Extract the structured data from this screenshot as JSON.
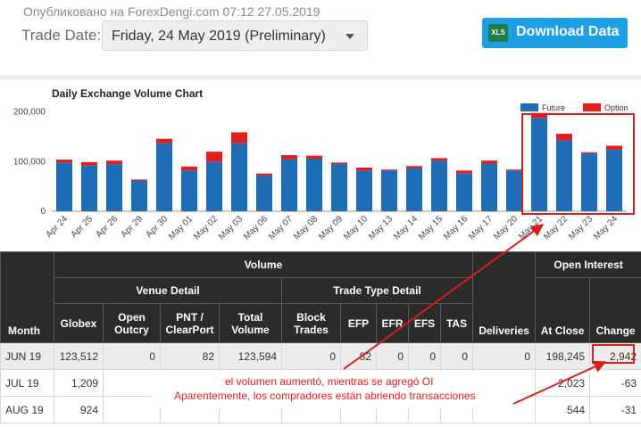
{
  "header": {
    "published": "Опубликовано на ForexDengi.com 07:12 27.05.2019",
    "trade_date_label": "Trade Date:",
    "trade_date_value": "Friday, 24 May 2019 (Preliminary)",
    "download_icon_text": "XLS",
    "download_label": "Download Data"
  },
  "chart_data": {
    "type": "bar",
    "title": "Daily Exchange Volume Chart",
    "stacked": true,
    "categories": [
      "Apr 24",
      "Apr 25",
      "Apr 26",
      "Apr 29",
      "Apr 30",
      "May 01",
      "May 02",
      "May 03",
      "May 06",
      "May 07",
      "May 08",
      "May 09",
      "May 10",
      "May 13",
      "May 14",
      "May 15",
      "May 16",
      "May 17",
      "May 20",
      "May 21",
      "May 22",
      "May 23",
      "May 24"
    ],
    "series": [
      {
        "name": "Future",
        "color": "#1f6db5",
        "values": [
          98000,
          92000,
          95000,
          62000,
          137000,
          82000,
          100000,
          137000,
          72000,
          105000,
          106000,
          95000,
          82000,
          82000,
          87000,
          102000,
          76000,
          96000,
          82000,
          188000,
          143000,
          117000,
          124000
        ]
      },
      {
        "name": "Option",
        "color": "#e31c1c",
        "values": [
          6000,
          7000,
          7000,
          2000,
          9000,
          8000,
          20000,
          22000,
          4000,
          8000,
          6000,
          3000,
          6000,
          2000,
          4000,
          5000,
          6000,
          6000,
          2000,
          10000,
          13000,
          2000,
          8000
        ]
      }
    ],
    "ylim": [
      0,
      210000
    ],
    "yticks": [
      0,
      100000,
      200000
    ],
    "ytick_labels": [
      "0",
      "100,000",
      "200,000"
    ],
    "legend": "top-right",
    "grid": false
  },
  "table": {
    "group_headers": {
      "volume": "Volume",
      "venue_detail": "Venue Detail",
      "trade_type_detail": "Trade Type Detail",
      "open_interest": "Open Interest"
    },
    "columns": {
      "month": "Month",
      "globex": "Globex",
      "open_outcry": "Open Outcry",
      "pnt_clearport": "PNT / ClearPort",
      "total_volume": "Total Volume",
      "block_trades": "Block Trades",
      "efp": "EFP",
      "efr": "EFR",
      "efs": "EFS",
      "tas": "TAS",
      "deliveries": "Deliveries",
      "at_close": "At Close",
      "change": "Change"
    },
    "rows": [
      {
        "month": "JUN 19",
        "globex": "123,512",
        "open_outcry": "0",
        "pnt_clearport": "82",
        "total_volume": "123,594",
        "block_trades": "0",
        "efp": "82",
        "efr": "0",
        "efs": "0",
        "tas": "0",
        "deliveries": "0",
        "at_close": "198,245",
        "change": "2,942"
      },
      {
        "month": "JUL 19",
        "globex": "1,209",
        "at_close": "2,023",
        "change": "-63"
      },
      {
        "month": "AUG 19",
        "globex": "924",
        "at_close": "544",
        "change": "-31"
      }
    ]
  },
  "annotation": {
    "line1": "el volumen aumentó, mientras se agregó OI",
    "line2": "Aparentemente, los compradores están abriendo transacciones",
    "color": "#e31c1c"
  }
}
